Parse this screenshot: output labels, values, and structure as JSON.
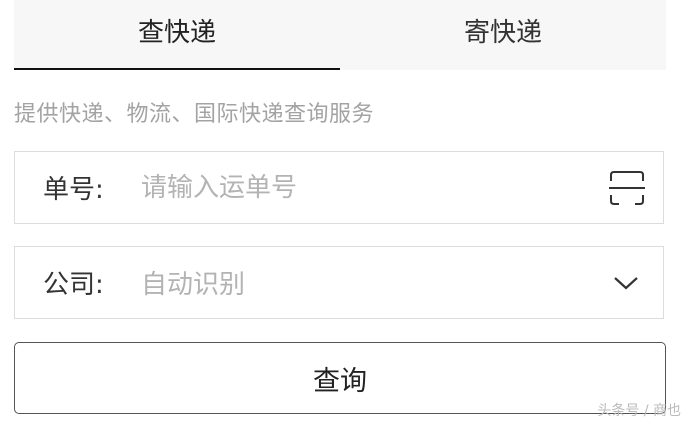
{
  "tabs": [
    {
      "label": "查快递",
      "active": true
    },
    {
      "label": "寄快递",
      "active": false
    }
  ],
  "subtitle": "提供快递、物流、国际快递查询服务",
  "tracking": {
    "label": "单号:",
    "placeholder": "请输入运单号",
    "icon": "scan-icon"
  },
  "company": {
    "label": "公司:",
    "value": "自动识别",
    "icon": "chevron-down-icon"
  },
  "query_button_label": "查询",
  "watermark": "头条号 / 商也",
  "colors": {
    "tab_background": "#f7f7f7",
    "active_underline": "#111111",
    "placeholder": "#b3b3b3",
    "border": "#dcdcdc"
  }
}
